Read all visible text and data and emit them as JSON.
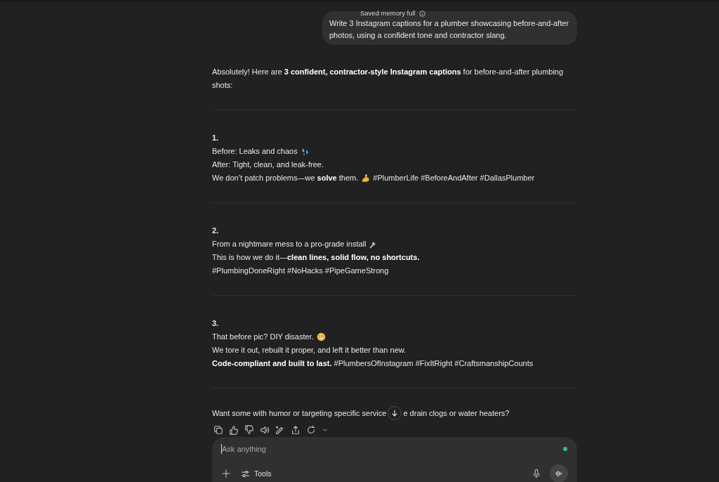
{
  "user_message": {
    "badge": "Saved memory full",
    "text": "Write 3 Instagram captions for a plumber showcasing before-and-after photos, using a confident tone and contractor slang."
  },
  "response": {
    "intro": "Absolutely! Here are **3 confident, contractor-style Instagram captions** for before-and-after plumbing shots:",
    "captions": [
      {
        "number": "1.",
        "lines": [
          {
            "text": "Before: Leaks and chaos",
            "kind": "droplets"
          },
          {
            "text": "After: Tight, clean, and leak-free."
          },
          {
            "text": "We don’t patch problems—we **solve** them.",
            "kind": "muscle",
            "after": "#PlumberLife #BeforeAndAfter #DallasPlumber"
          }
        ]
      },
      {
        "number": "2.",
        "lines": [
          {
            "text": "From a nightmare mess to a pro-grade install",
            "kind": "wrench"
          },
          {
            "text": "This is how we do it—**clean lines, solid flow, no shortcuts.**"
          },
          {
            "text": "#PlumbingDoneRight #NoHacks #PipeGameStrong"
          }
        ]
      },
      {
        "number": "3.",
        "lines": [
          {
            "text": "That before pic? DIY disaster.",
            "kind": "grimace"
          },
          {
            "text": "We tore it out, rebuilt it proper, and left it better than new."
          },
          {
            "text": "**Code-compliant and built to last.** #PlumbersOfInstagram #FixItRight #CraftsmanshipCounts"
          }
        ]
      }
    ],
    "closing_before": "Want some with humor or targeting specific service",
    "closing_after": "e drain clogs or water heaters?"
  },
  "composer": {
    "placeholder": "Ask anything",
    "tools_label": "Tools"
  }
}
